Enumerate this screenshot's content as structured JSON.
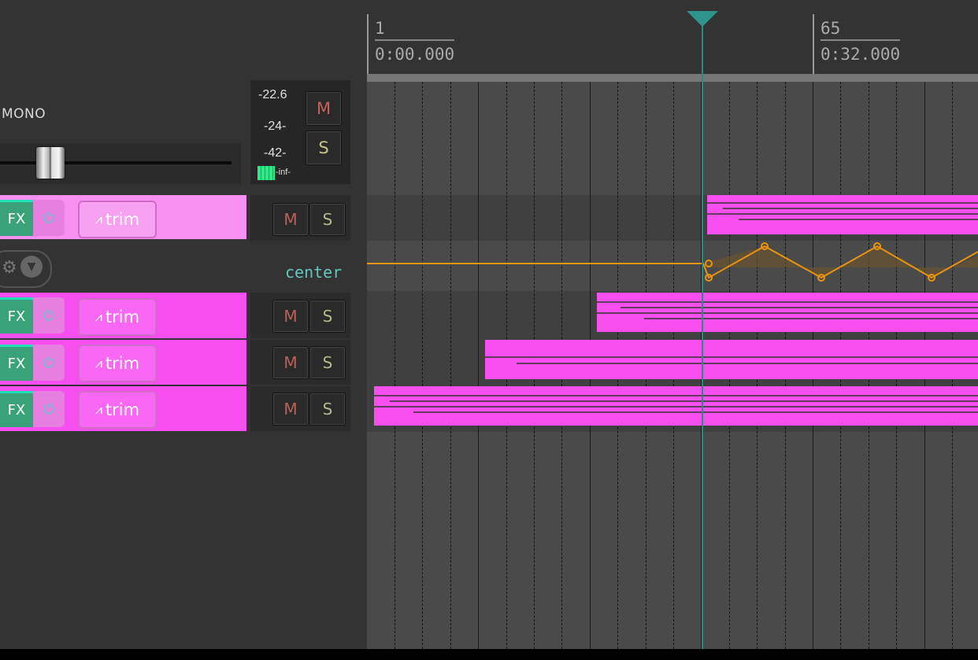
{
  "track_header": {
    "channel_mode": "MONO",
    "meter": {
      "peak": "-22.6",
      "mark1": "-24-",
      "mark2": "-42-",
      "mark3": "-inf-"
    },
    "mute_label": "M",
    "solo_label": "S"
  },
  "tracks": [
    {
      "fx_label": "FX",
      "trim_label": "trim",
      "mute_label": "M",
      "solo_label": "S"
    },
    {
      "fx_label": "FX",
      "trim_label": "trim",
      "mute_label": "M",
      "solo_label": "S"
    },
    {
      "fx_label": "FX",
      "trim_label": "trim",
      "mute_label": "M",
      "solo_label": "S"
    },
    {
      "fx_label": "FX",
      "trim_label": "trim",
      "mute_label": "M",
      "solo_label": "S"
    }
  ],
  "envelope_lane": {
    "value_label": "center"
  },
  "ruler": [
    {
      "measure": "1",
      "time": "0:00.000"
    },
    {
      "measure": "65",
      "time": "0:32.000"
    }
  ],
  "colors": {
    "item_pink": "#f74ef0",
    "item_light_pink": "#f790f0",
    "fx_green": "#3aa27a",
    "envelope_orange": "#e8940f",
    "cursor_teal": "#2f948b"
  },
  "icons": [
    "power-icon",
    "envelope-icon",
    "gear-icon",
    "chevron-down-icon"
  ]
}
